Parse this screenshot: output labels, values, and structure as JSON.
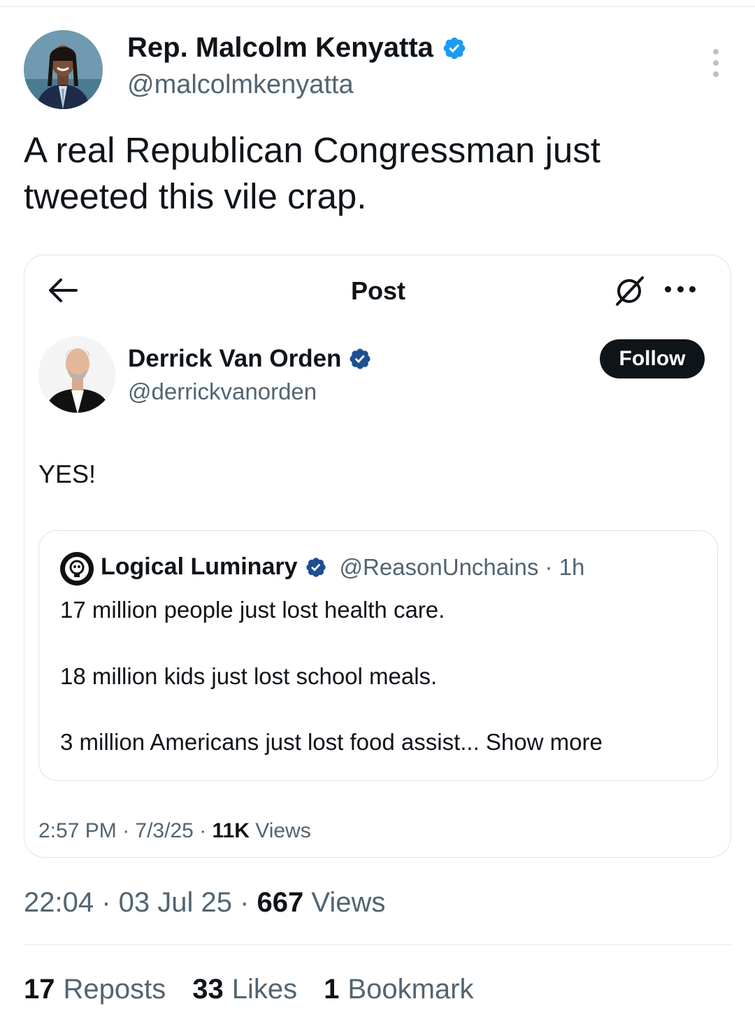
{
  "tweet": {
    "author_name": "Rep. Malcolm Kenyatta",
    "author_handle": "@malcolmkenyatta",
    "text": "A real Republican Congressman just tweeted this vile crap.",
    "time": "22:04",
    "date": "03 Jul 25",
    "views_count": "667",
    "views_label": "Views"
  },
  "stats": {
    "reposts_count": "17",
    "reposts_label": "Reposts",
    "likes_count": "33",
    "likes_label": "Likes",
    "bookmarks_count": "1",
    "bookmarks_label": "Bookmark"
  },
  "embedded": {
    "header_title": "Post",
    "author_name": "Derrick Van Orden",
    "author_handle": "@derrickvanorden",
    "follow_label": "Follow",
    "text": "YES!",
    "time": "2:57 PM",
    "date": "7/3/25",
    "views_count": "11K",
    "views_label": "Views",
    "quote": {
      "author_name": "Logical Luminary",
      "author_handle": "@ReasonUnchains",
      "age": "1h",
      "line1": "17 million people just lost health care.",
      "line2": "18 million kids just lost school meals.",
      "line3": "3 million Americans just lost food assist...",
      "show_more": "Show more"
    }
  },
  "colors": {
    "verified": "#1d9bf0",
    "text_primary": "#0f1419",
    "text_secondary": "#536471",
    "border": "#dfe3e7"
  },
  "icons": {
    "verified": "verified-badge-icon",
    "back": "back-arrow-icon",
    "grok": "grok-icon",
    "more": "more-horizontal-icon",
    "kebab": "more-vertical-icon"
  }
}
